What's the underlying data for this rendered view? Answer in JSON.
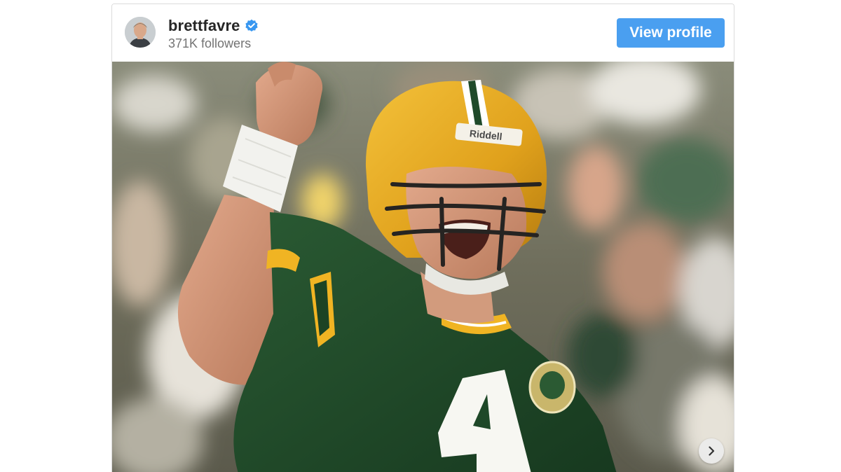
{
  "embed": {
    "username": "brettfavre",
    "followers": "371K followers",
    "view_profile_label": "View profile",
    "verified": true
  },
  "photo": {
    "description_icon": "football-player-photo",
    "jersey_number": "4",
    "helmet_brand": "Riddell"
  },
  "icons": {
    "verified": "verified-badge-icon",
    "next": "chevron-right-icon"
  },
  "colors": {
    "button": "#4a9ff0",
    "verified": "#3897f0",
    "username": "#262626",
    "followers": "#737373",
    "jersey_green": "#1f4a2a",
    "helmet_gold": "#e6a91f"
  }
}
